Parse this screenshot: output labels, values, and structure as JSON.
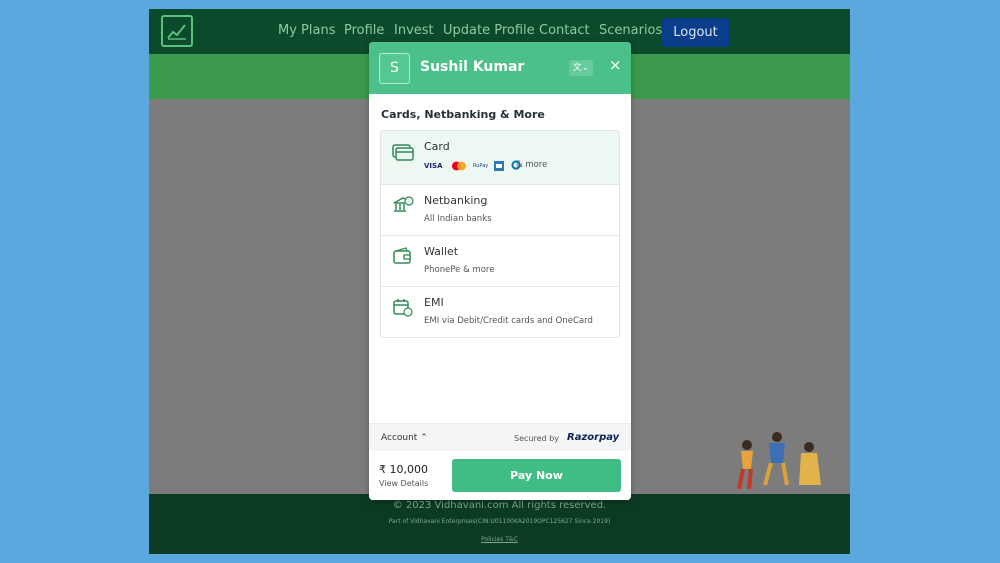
{
  "nav": {
    "links": [
      "My Plans",
      "Profile",
      "Invest",
      "Update Profile",
      "Contact",
      "Scenarios"
    ],
    "logout": "Logout"
  },
  "footer": {
    "copyright": "© 2023 Vidhavani.com All rights reserved.",
    "company": "Part of Vidhavani Enterprises(CIN:U01100KA2019OPC125627 Since 2019)",
    "policies": "Policies T&C"
  },
  "checkout": {
    "avatar_letter": "S",
    "merchant_name": "Sushil Kumar",
    "language_icon": "translate-icon",
    "close_symbol": "×",
    "section_title": "Cards, Netbanking & More",
    "methods": [
      {
        "title": "Card",
        "subtitle": "& more",
        "networks": [
          "VISA",
          "Mastercard",
          "RuPay",
          "Amex",
          "Diners Club"
        ]
      },
      {
        "title": "Netbanking",
        "subtitle": "All Indian banks"
      },
      {
        "title": "Wallet",
        "subtitle": "PhonePe & more"
      },
      {
        "title": "EMI",
        "subtitle": "EMI via Debit/Credit cards and OneCard"
      }
    ],
    "account_label": "Account",
    "secured_by": "Secured by",
    "provider": "Razorpay",
    "amount": "₹ 10,000",
    "view_details": "View Details",
    "pay_button": "Pay Now"
  },
  "colors": {
    "page_bg": "#5ba8df",
    "nav_bg": "#0b4a2b",
    "checkout_accent": "#4cc08b",
    "pay_button": "#3fbd84",
    "logout_bg": "#0a3d8c"
  }
}
